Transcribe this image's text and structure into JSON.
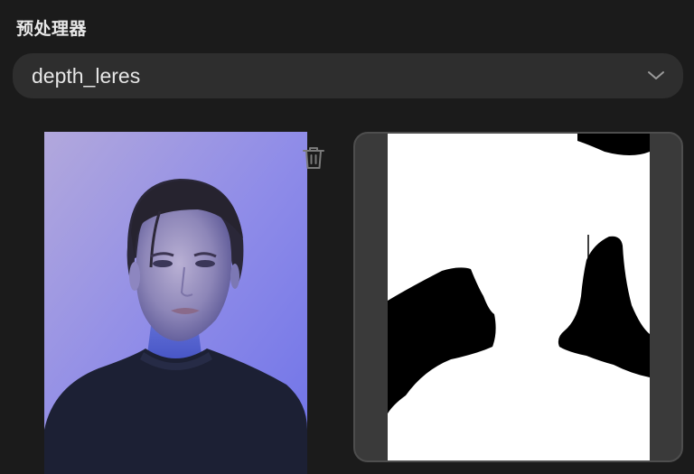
{
  "section": {
    "title": "预处理器"
  },
  "preprocessor_select": {
    "value": "depth_leres",
    "icon": "chevron-down-icon"
  },
  "input_image": {
    "description_icon": "portrait-photo",
    "delete_icon": "trash-icon"
  },
  "output_image": {
    "icon": "depth-map"
  },
  "colors": {
    "background": "#1b1b1b",
    "select_bg": "#2e2e2e",
    "text": "#e6e6e6",
    "frame_border": "#4e4e4e"
  }
}
